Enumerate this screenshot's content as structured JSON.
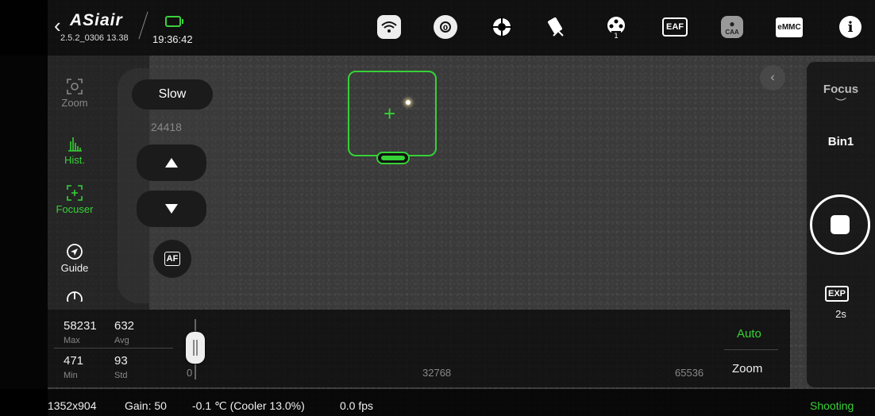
{
  "app": {
    "logo": "ASiair",
    "version": "2.5.2_0306 13.38",
    "time": "19:36:42"
  },
  "topbar_icons": [
    "wifi-icon",
    "camera-icon",
    "guide-target-icon",
    "telescope-icon",
    "filter-wheel-icon",
    "eaf-icon",
    "caa-icon",
    "emmc-icon",
    "info-icon"
  ],
  "topbar_labels": {
    "eaf": "EAF",
    "caa": "CAA",
    "emmc": "eMMC",
    "info": "i",
    "filter_num": "1"
  },
  "left_tools": [
    {
      "label": "Zoom",
      "state": "disabled"
    },
    {
      "label": "Hist.",
      "state": "active"
    },
    {
      "label": "Focuser",
      "state": "active"
    },
    {
      "label": "Guide",
      "state": "normal"
    }
  ],
  "focuser": {
    "speed": "Slow",
    "position": "24418",
    "af_label": "AF"
  },
  "right_panel": {
    "focus_label": "Focus",
    "bin_label": "Bin1",
    "exp_label": "EXP",
    "exp_value": "2s",
    "mode": "Shooting"
  },
  "histogram": {
    "max": "58231",
    "max_label": "Max",
    "avg": "632",
    "avg_label": "Avg",
    "min": "471",
    "min_label": "Min",
    "std": "93",
    "std_label": "Std",
    "tick_0": "0",
    "tick_mid": "32768",
    "tick_max": "65536",
    "auto_label": "Auto",
    "zoom_label": "Zoom",
    "stretch_position": 0.0
  },
  "status": {
    "resolution": "1352x904",
    "gain": "Gain: 50",
    "temp": "-0.1 ℃ (Cooler 13.0%)",
    "fps": "0.0 fps"
  },
  "colors": {
    "accent": "#36d136",
    "background": "#3a3a3a"
  }
}
